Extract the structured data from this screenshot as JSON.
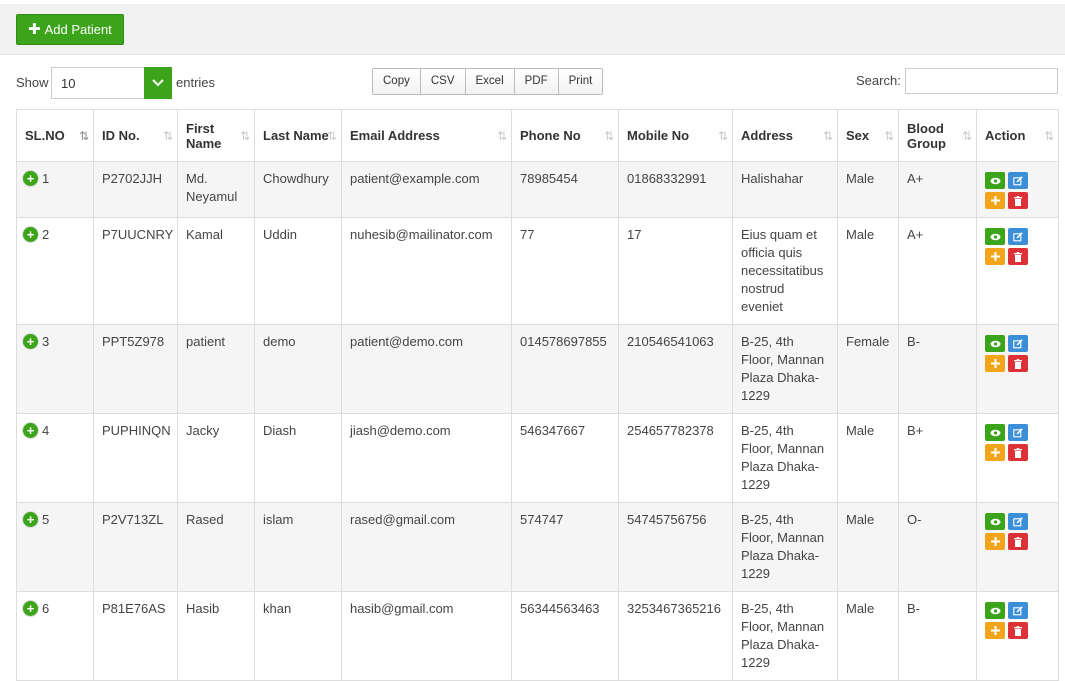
{
  "toolbar": {
    "add_patient_label": "Add Patient"
  },
  "controls": {
    "show_label": "Show",
    "page_length": "10",
    "entries_label": "entries",
    "export_buttons": [
      "Copy",
      "CSV",
      "Excel",
      "PDF",
      "Print"
    ],
    "search_label": "Search:",
    "search_value": ""
  },
  "table": {
    "headers": [
      "SL.NO",
      "ID No.",
      "First Name",
      "Last Name",
      "Email Address",
      "Phone No",
      "Mobile No",
      "Address",
      "Sex",
      "Blood Group",
      "Action"
    ],
    "rows": [
      {
        "sl": "1",
        "id": "P2702JJH",
        "first": "Md. Neyamul",
        "last": "Chowdhury",
        "email": "patient@example.com",
        "phone": "78985454",
        "mobile": "01868332991",
        "address": "Halishahar",
        "sex": "Male",
        "blood": "A+"
      },
      {
        "sl": "2",
        "id": "P7UUCNRY",
        "first": "Kamal",
        "last": "Uddin",
        "email": "nuhesib@mailinator.com",
        "phone": "77",
        "mobile": "17",
        "address": "Eius quam et officia quis necessitatibus nostrud eveniet",
        "sex": "Male",
        "blood": "A+"
      },
      {
        "sl": "3",
        "id": "PPT5Z978",
        "first": "patient",
        "last": "demo",
        "email": "patient@demo.com",
        "phone": "014578697855",
        "mobile": "210546541063",
        "address": "B-25, 4th Floor, Mannan Plaza Dhaka-1229",
        "sex": "Female",
        "blood": "B-"
      },
      {
        "sl": "4",
        "id": "PUPHINQN",
        "first": "Jacky",
        "last": "Diash",
        "email": "jiash@demo.com",
        "phone": "546347667",
        "mobile": "254657782378",
        "address": "B-25, 4th Floor, Mannan Plaza Dhaka-1229",
        "sex": "Male",
        "blood": "B+"
      },
      {
        "sl": "5",
        "id": "P2V713ZL",
        "first": "Rased",
        "last": "islam",
        "email": "rased@gmail.com",
        "phone": "574747",
        "mobile": "54745756756",
        "address": "B-25, 4th Floor, Mannan Plaza Dhaka-1229",
        "sex": "Male",
        "blood": "O-"
      },
      {
        "sl": "6",
        "id": "P81E76AS",
        "first": "Hasib",
        "last": "khan",
        "email": "hasib@gmail.com",
        "phone": "56344563463",
        "mobile": "3253467365216",
        "address": "B-25, 4th Floor, Mannan Plaza Dhaka-1229",
        "sex": "Male",
        "blood": "B-"
      }
    ]
  },
  "icons": {
    "expand": "plus-circle-icon",
    "view": "eye-icon",
    "edit": "pencil-square-icon",
    "add": "plus-icon",
    "delete": "trash-icon",
    "sort": "sort-arrows-icon",
    "dropdown": "chevron-down-icon"
  },
  "colors": {
    "primary_green": "#3ca41a",
    "edit_blue": "#3b8fd8",
    "add_orange": "#f2a51a",
    "delete_red": "#dc3237"
  }
}
